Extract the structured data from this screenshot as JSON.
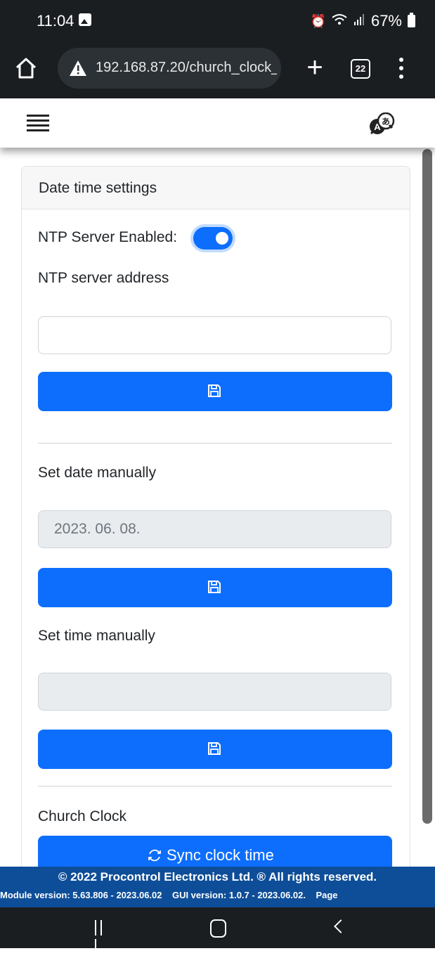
{
  "status_bar": {
    "time": "11:04",
    "battery": "67%",
    "icons": [
      "image-icon",
      "alarm-icon",
      "wifi-icon",
      "signal-icon",
      "battery-icon"
    ]
  },
  "browser": {
    "url": "192.168.87.20/church_clock_",
    "tab_count": "22",
    "icons": [
      "home-icon",
      "warning-icon",
      "plus-icon",
      "tabs-icon",
      "more-icon"
    ]
  },
  "app_nav": {
    "icons": [
      "hamburger-icon",
      "language-icon"
    ]
  },
  "card": {
    "title": "Date time settings",
    "ntp_enabled_label": "NTP Server Enabled:",
    "ntp_enabled": true,
    "ntp_address_label": "NTP server address",
    "ntp_address_value": "",
    "set_date_label": "Set date manually",
    "date_value": "2023. 06. 08.",
    "set_time_label": "Set time manually",
    "time_value": "",
    "church_clock_label": "Church Clock",
    "sync_button_label": "Sync clock time",
    "save_icon": "save-icon"
  },
  "footer": {
    "copyright": "© 2022 Procontrol Electronics Ltd. ® All rights reserved.",
    "versions": "Module version: 5.63.806 - 2023.06.02    GUI version: 1.0.7 - 2023.06.02.    Page"
  },
  "colors": {
    "primary": "#0d6efd",
    "footer": "#0e4e99",
    "system_bar": "#1b1e21"
  }
}
